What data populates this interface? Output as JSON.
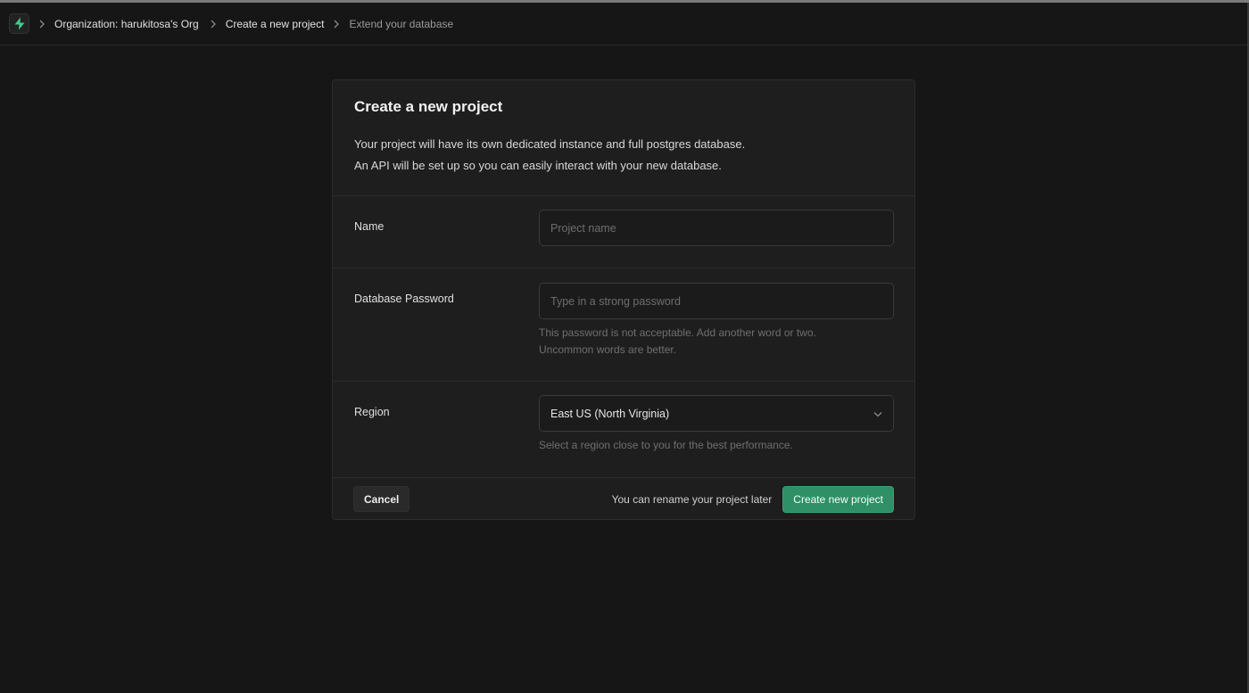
{
  "breadcrumb": {
    "items": [
      {
        "label": "Organization: harukitosa's Org"
      },
      {
        "label": "Create a new project"
      },
      {
        "label": "Extend your database"
      }
    ]
  },
  "card": {
    "title": "Create a new project",
    "description_line1": "Your project will have its own dedicated instance and full postgres database.",
    "description_line2": "An API will be set up so you can easily interact with your new database."
  },
  "form": {
    "name": {
      "label": "Name",
      "value": "",
      "placeholder": "Project name"
    },
    "password": {
      "label": "Database Password",
      "value": "",
      "placeholder": "Type in a strong password",
      "help_line1": "This password is not acceptable. Add another word or two.",
      "help_line2": "Uncommon words are better."
    },
    "region": {
      "label": "Region",
      "selected": "East US (North Virginia)",
      "help": "Select a region close to you for the best performance."
    }
  },
  "footer": {
    "cancel_label": "Cancel",
    "note": "You can rename your project later",
    "create_label": "Create new project"
  },
  "icons": {
    "logo": "supabase-bolt-icon",
    "separator": "chevron-right-icon",
    "select": "chevron-down-icon"
  },
  "colors": {
    "background": "#161616",
    "card": "#1e1e1e",
    "accent": "#2f8f66",
    "logo": "#3ecf8e"
  }
}
